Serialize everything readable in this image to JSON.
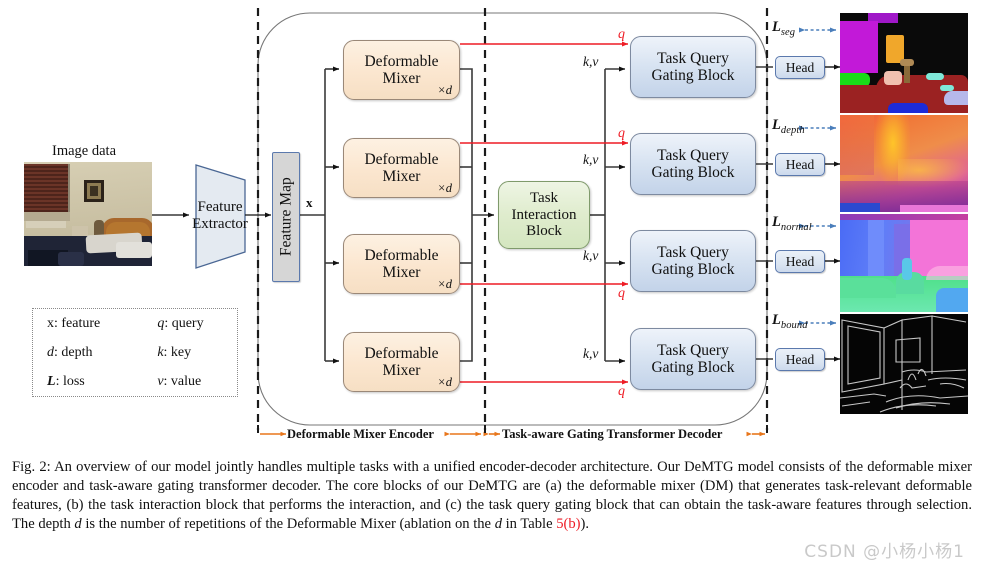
{
  "figure": {
    "input": {
      "image_caption": "Image data",
      "feature_extractor_label": "Feature\nExtractor"
    },
    "feature_map": {
      "label": "Feature Map",
      "x_label": "x"
    },
    "encoder": {
      "block_label": "Deformable\nMixer",
      "repeat_label": "×d",
      "span_label": "Deformable Mixer Encoder",
      "blocks": [
        {
          "label": "Deformable Mixer",
          "repeat": "×d"
        },
        {
          "label": "Deformable Mixer",
          "repeat": "×d"
        },
        {
          "label": "Deformable Mixer",
          "repeat": "×d"
        },
        {
          "label": "Deformable Mixer",
          "repeat": "×d"
        }
      ]
    },
    "interaction": {
      "label": "Task\nInteraction\nBlock"
    },
    "decoder": {
      "block_label": "Task Query\nGating Block",
      "span_label": "Task-aware Gating Transformer Decoder",
      "kv_label": "k,v",
      "q_label": "q",
      "blocks": [
        {
          "label": "Task Query Gating Block",
          "kv": "k,v",
          "q": "q"
        },
        {
          "label": "Task Query Gating Block",
          "kv": "k,v",
          "q": "q"
        },
        {
          "label": "Task Query Gating Block",
          "kv": "k,v",
          "q": "q"
        },
        {
          "label": "Task Query Gating Block",
          "kv": "k,v",
          "q": "q"
        }
      ]
    },
    "heads": [
      {
        "label": "Head",
        "loss_symbol": "L",
        "loss_sub": "seg",
        "task": "segmentation"
      },
      {
        "label": "Head",
        "loss_symbol": "L",
        "loss_sub": "depth",
        "task": "depth"
      },
      {
        "label": "Head",
        "loss_symbol": "L",
        "loss_sub": "normal",
        "task": "normal"
      },
      {
        "label": "Head",
        "loss_symbol": "L",
        "loss_sub": "bound",
        "task": "boundary"
      }
    ],
    "legend": {
      "rows": [
        {
          "sym_left": "x",
          "sym_left_italic": false,
          "text_left": ": feature",
          "sym_right": "q",
          "sym_right_italic": true,
          "text_right": ": query"
        },
        {
          "sym_left": "d",
          "sym_left_italic": true,
          "text_left": ": depth",
          "sym_right": "k",
          "sym_right_italic": true,
          "text_right": ": key"
        },
        {
          "sym_left": "L",
          "sym_left_italic": true,
          "text_left": ": loss",
          "sym_right": "v",
          "sym_right_italic": true,
          "text_right": ": value"
        }
      ]
    },
    "colors": {
      "query_arrow": "#ee1c25",
      "span_arrow": "#e8761b",
      "loss_arrow": "#4a7ebb",
      "dashed_divider": "#1a1a1a",
      "deformable_mixer_fill": "#fbe6cf",
      "task_query_fill": "#d9e4f2",
      "task_interaction_fill": "#dfeccd",
      "feature_map_fill": "#d6d6d6",
      "head_fill": "#dbe5f2"
    }
  },
  "caption": {
    "prefix": "Fig. 2:",
    "text_before_table": " An overview of our model jointly handles multiple tasks with a unified encoder-decoder architecture. Our DeMTG model consists of the deformable mixer encoder and task-aware gating transformer decoder. The core blocks of our DeMTG are (a) the deformable mixer (DM) that generates task-relevant deformable features, (b) the task interaction block that performs the interaction, and (c) the task query gating block that can obtain the task-aware features through selection. The depth ",
    "italic_d": "d",
    "text_mid": " is the number of repetitions of the Deformable Mixer (ablation on the ",
    "italic_d2": "d",
    "text_after": " in Table ",
    "table_ref": "5(b)",
    "text_end": ")."
  },
  "watermark": "CSDN @小杨小杨1"
}
